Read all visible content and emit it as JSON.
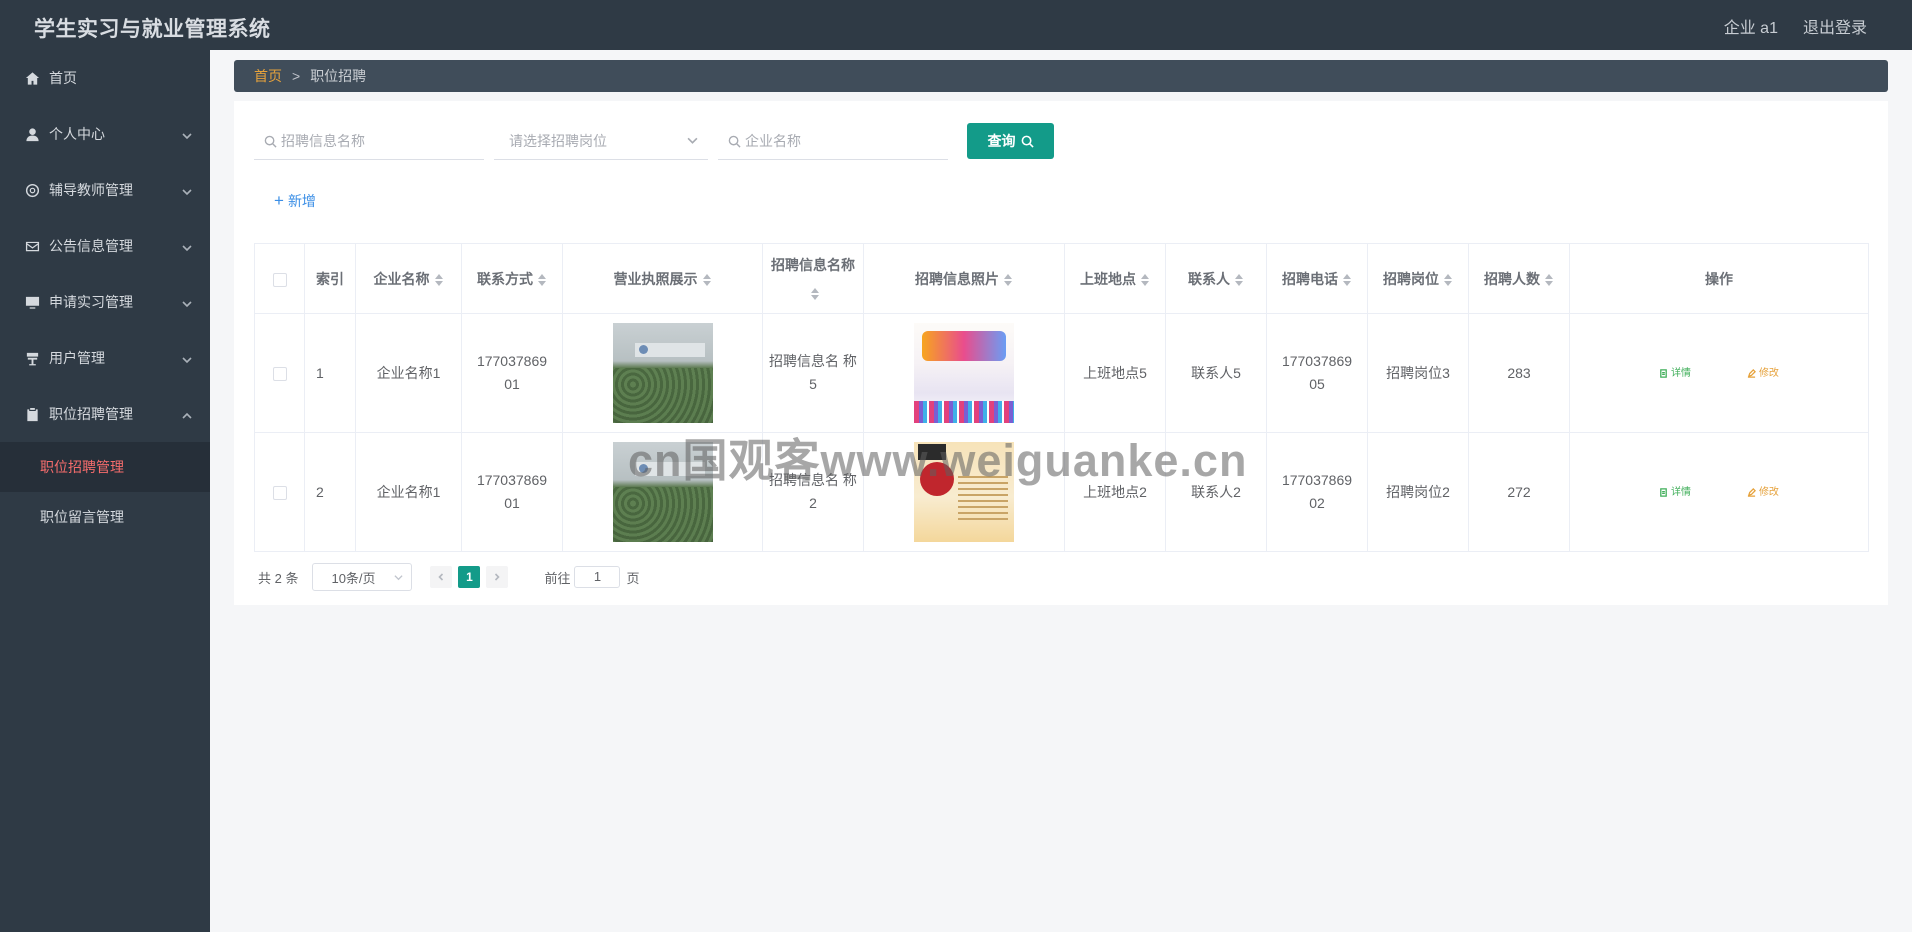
{
  "header": {
    "app_title": "学生实习与就业管理系统",
    "user_label": "企业 a1",
    "logout_label": "退出登录"
  },
  "sidebar": {
    "items": [
      {
        "label": "首页",
        "icon": "home-icon"
      },
      {
        "label": "个人中心",
        "icon": "user-icon"
      },
      {
        "label": "辅导教师管理",
        "icon": "lifebuoy-icon"
      },
      {
        "label": "公告信息管理",
        "icon": "mail-icon"
      },
      {
        "label": "申请实习管理",
        "icon": "monitor-icon"
      },
      {
        "label": "用户管理",
        "icon": "podium-icon"
      },
      {
        "label": "职位招聘管理",
        "icon": "clipboard-icon"
      }
    ],
    "sub_items": [
      {
        "label": "职位招聘管理",
        "active": true
      },
      {
        "label": "职位留言管理",
        "active": false
      }
    ]
  },
  "breadcrumb": {
    "home": "首页",
    "separator": ">",
    "current": "职位招聘"
  },
  "search": {
    "name_placeholder": "招聘信息名称",
    "position_placeholder": "请选择招聘岗位",
    "company_placeholder": "企业名称",
    "query_label": "查询"
  },
  "toolbar": {
    "add_label": "新增"
  },
  "table": {
    "columns": [
      "索引",
      "企业名称",
      "联系方式",
      "营业执照展示",
      "招聘信息名称",
      "招聘信息照片",
      "上班地点",
      "联系人",
      "招聘电话",
      "招聘岗位",
      "招聘人数",
      "操作"
    ],
    "rows": [
      {
        "index": "1",
        "company": "企业名称1",
        "contact": "177037869 01",
        "title": "招聘信息名 称5",
        "location": "上班地点5",
        "person": "联系人5",
        "phone": "177037869 05",
        "position": "招聘岗位3",
        "count": "283",
        "detail": "详情",
        "edit": "修改"
      },
      {
        "index": "2",
        "company": "企业名称1",
        "contact": "177037869 01",
        "title": "招聘信息名 称2",
        "location": "上班地点2",
        "person": "联系人2",
        "phone": "177037869 02",
        "position": "招聘岗位2",
        "count": "272",
        "detail": "详情",
        "edit": "修改"
      }
    ]
  },
  "pagination": {
    "total": "共 2 条",
    "page_size": "10条/页",
    "current_page": "1",
    "goto_prefix": "前往",
    "goto_value": "1",
    "goto_suffix": "页"
  },
  "watermark": "cn国观客www.weiguanke.cn",
  "colors": {
    "sidebar_bg": "#2f3a45",
    "accent": "#139b89",
    "active_menu": "#f56c6c",
    "breadcrumb_home": "#e6a23c"
  }
}
